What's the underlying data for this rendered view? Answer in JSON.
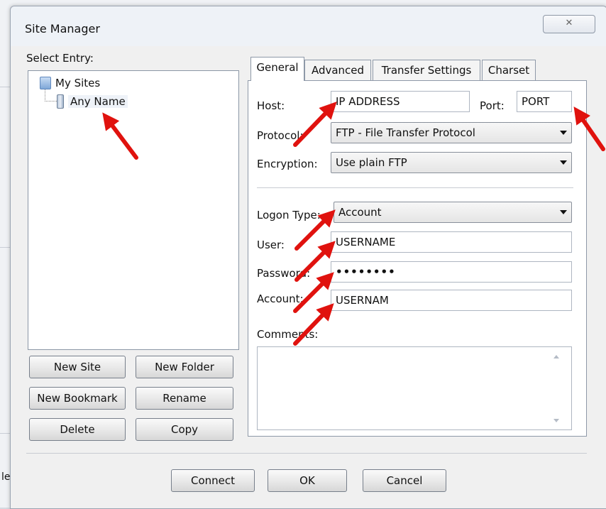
{
  "dialog": {
    "title": "Site Manager",
    "close_glyph": "✕"
  },
  "left": {
    "select_entry_label": "Select Entry:",
    "tree": [
      {
        "label": "My Sites",
        "icon": "folder-icon"
      },
      {
        "label": "Any Name",
        "icon": "server-icon",
        "selected": true
      }
    ],
    "buttons": {
      "new_site": "New Site",
      "new_folder": "New Folder",
      "new_bookmark": "New Bookmark",
      "rename": "Rename",
      "delete": "Delete",
      "copy": "Copy"
    }
  },
  "tabs": [
    "General",
    "Advanced",
    "Transfer Settings",
    "Charset"
  ],
  "general": {
    "host_label": "Host:",
    "host_value": "IP ADDRESS",
    "port_label": "Port:",
    "port_value": "PORT",
    "protocol_label": "Protocol:",
    "protocol_value": "FTP - File Transfer Protocol",
    "encryption_label": "Encryption:",
    "encryption_value": "Use plain FTP",
    "logon_type_label": "Logon Type:",
    "logon_type_value": "Account",
    "user_label": "User:",
    "user_value": "USERNAME",
    "password_label": "Password:",
    "password_value": "••••••••",
    "account_label": "Account:",
    "account_value": "USERNAM",
    "comments_label": "Comments:",
    "comments_value": ""
  },
  "footer": {
    "connect": "Connect",
    "ok": "OK",
    "cancel": "Cancel"
  },
  "background_fragments": {
    "left_a": "le"
  },
  "colors": {
    "annotation_arrow": "#e0120e"
  }
}
